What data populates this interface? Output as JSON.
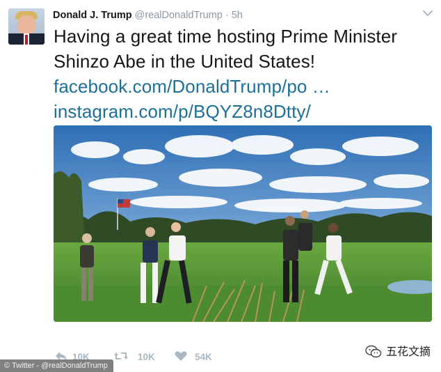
{
  "tweet": {
    "author_name": "Donald J. Trump",
    "handle": "@realDonaldTrump",
    "separator": "·",
    "time": "5h",
    "text_line1": "Having a great time hosting Prime Minister",
    "text_line2": "Shinzo Abe in the United States!",
    "link1": "facebook.com/DonaldTrump/po …",
    "link2": "instagram.com/p/BQYZ8n8Dtty/"
  },
  "actions": {
    "reply_icon": "reply-icon",
    "retweet_icon": "retweet-icon",
    "like_icon": "heart-icon",
    "reply_count": "10K",
    "retweet_count": "10K",
    "like_count": "54K"
  },
  "footer": {
    "credit": "© Twitter - @realDonaldTrump",
    "watermark": "五花文摘",
    "watermark_icon": "wechat-icon"
  },
  "colors": {
    "name": "#14171a",
    "muted": "#8899a6",
    "link": "#1b6f98",
    "action": "#aab8c2",
    "sky": "#4f86c7",
    "grass": "#5f9a3a"
  }
}
